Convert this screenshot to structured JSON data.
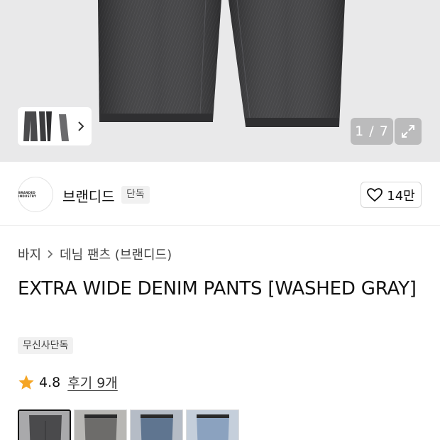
{
  "gallery": {
    "counter": "1 / 7",
    "expand_icon": "expand-icon",
    "thumbnail_chevron_icon": "chevron-right-icon"
  },
  "brand": {
    "logo_text": "BRANDED INDUSTRY",
    "name": "브랜디드",
    "exclusive_label": "단독",
    "likes": "14만"
  },
  "breadcrumb": {
    "category": "바지",
    "subcategory": "데님 팬츠 (브랜디드)"
  },
  "product": {
    "title": "EXTRA WIDE DENIM PANTS [WASHED GRAY]",
    "badge": "무신사단독",
    "rating": "4.8",
    "reviews": "후기 9개"
  },
  "colors": {
    "star": "#f5a524",
    "denim_dark": "#3b3b3d",
    "hero_bg": "#e9e9ea"
  },
  "variants": [
    {
      "name": "washed-gray",
      "color": "#4a4a4c",
      "selected": true
    },
    {
      "name": "vintage-gray",
      "color": "#6d6c6a",
      "selected": false
    },
    {
      "name": "mid-blue",
      "color": "#5f7590",
      "selected": false
    },
    {
      "name": "light-blue",
      "color": "#8ba2bf",
      "selected": false
    }
  ]
}
